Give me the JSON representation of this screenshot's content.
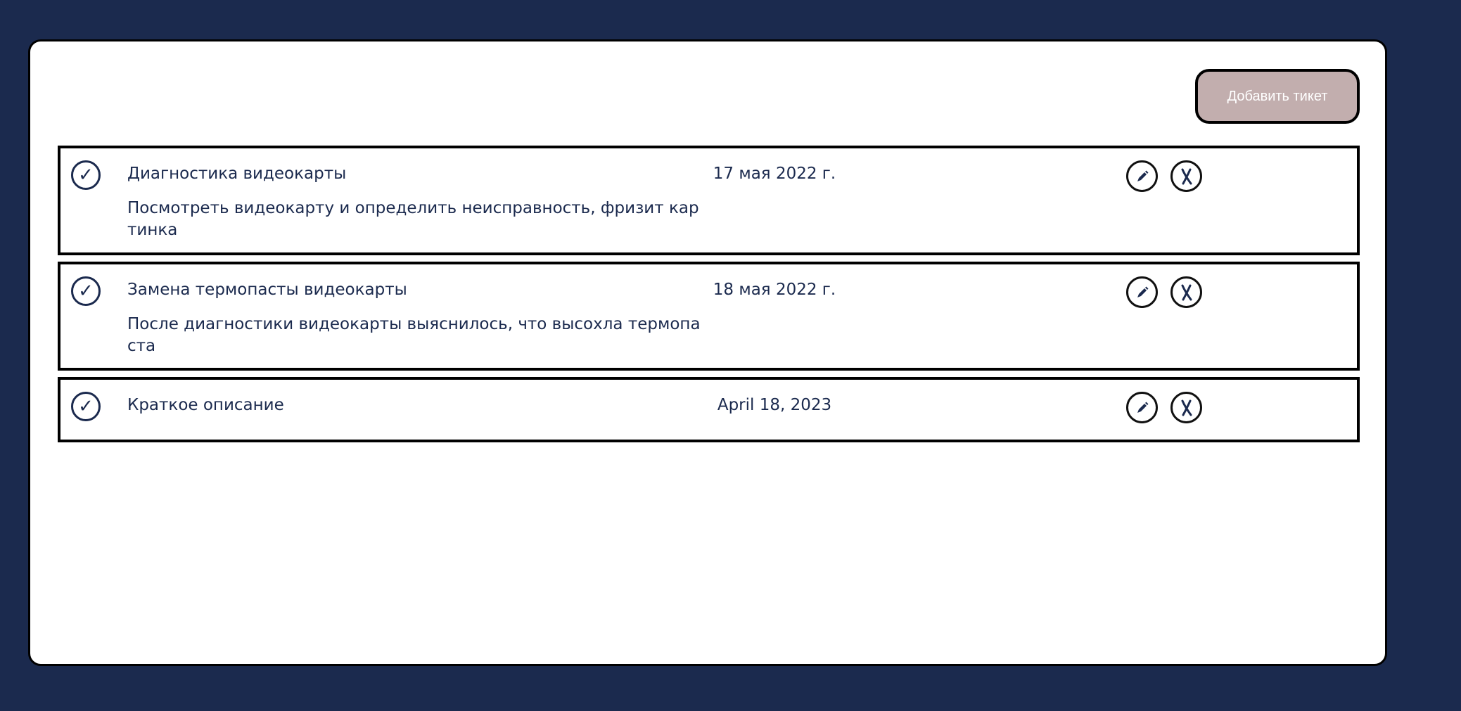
{
  "toolbar": {
    "add_ticket_label": "Добавить тикет"
  },
  "tickets": [
    {
      "title": "Диагностика видеокарты",
      "description": "Посмотреть видеокарту и определить неисправность, фризит картинка",
      "date": "17 мая 2022 г.",
      "done_icon": "checkmark-icon",
      "edit_icon": "pencil-icon",
      "delete_icon": "x-mark-icon"
    },
    {
      "title": "Замена термопасты видеокарты",
      "description": "После диагностики видеокарты выяснилось, что высохла термопаста",
      "date": "18 мая 2022 г.",
      "done_icon": "checkmark-icon",
      "edit_icon": "pencil-icon",
      "delete_icon": "x-mark-icon"
    },
    {
      "title": "Краткое описание",
      "description": "",
      "date": "April 18, 2023",
      "done_icon": "checkmark-icon",
      "edit_icon": "pencil-icon",
      "delete_icon": "x-mark-icon"
    }
  ],
  "colors": {
    "background": "#1b2a4e",
    "panel": "#ffffff",
    "text": "#1b2a4e",
    "add_button": "#c2aeae",
    "border": "#000000"
  }
}
